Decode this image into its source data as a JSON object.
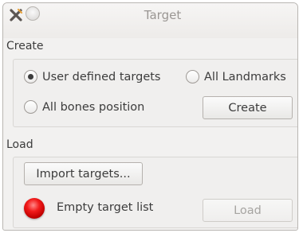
{
  "window": {
    "title": "Target"
  },
  "create_section": {
    "label": "Create",
    "options": [
      {
        "label": "User defined targets",
        "selected": true
      },
      {
        "label": "All Landmarks",
        "selected": false
      },
      {
        "label": "All bones position",
        "selected": false
      }
    ],
    "create_button": "Create"
  },
  "load_section": {
    "label": "Load",
    "import_button": "Import targets...",
    "status_text": "Empty target list",
    "status_color": "#e11a1a",
    "load_button": "Load"
  }
}
